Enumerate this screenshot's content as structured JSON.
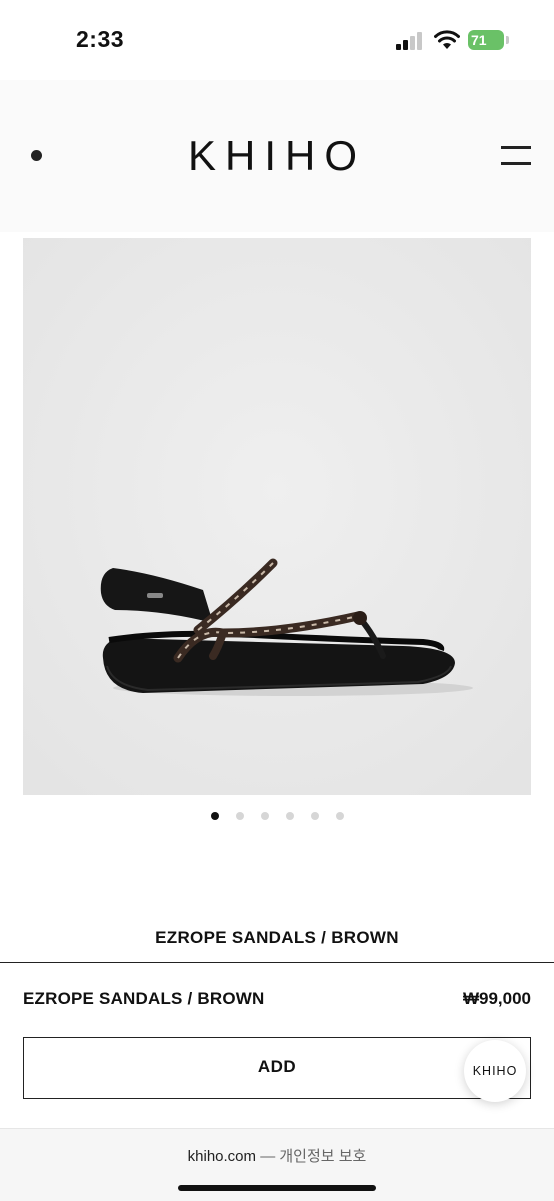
{
  "status_bar": {
    "time": "2:33",
    "battery_level": "71",
    "battery_color": "#6ac167"
  },
  "header": {
    "logo": "KHIHO",
    "left_icon": "dot-icon",
    "right_icon": "hamburger-menu-icon"
  },
  "product": {
    "image_description_icon": "sandal-image",
    "carousel": {
      "total": 6,
      "active": 1
    },
    "title": "EZROPE SANDALS / BROWN"
  },
  "purchase": {
    "name": "EZROPE SANDALS / BROWN",
    "price": "₩99,000",
    "add_label": "ADD"
  },
  "chat_button": {
    "label": "KHIHO"
  },
  "footer": {
    "domain": "khiho.com",
    "separator": " — ",
    "privacy": "개인정보 보호"
  }
}
